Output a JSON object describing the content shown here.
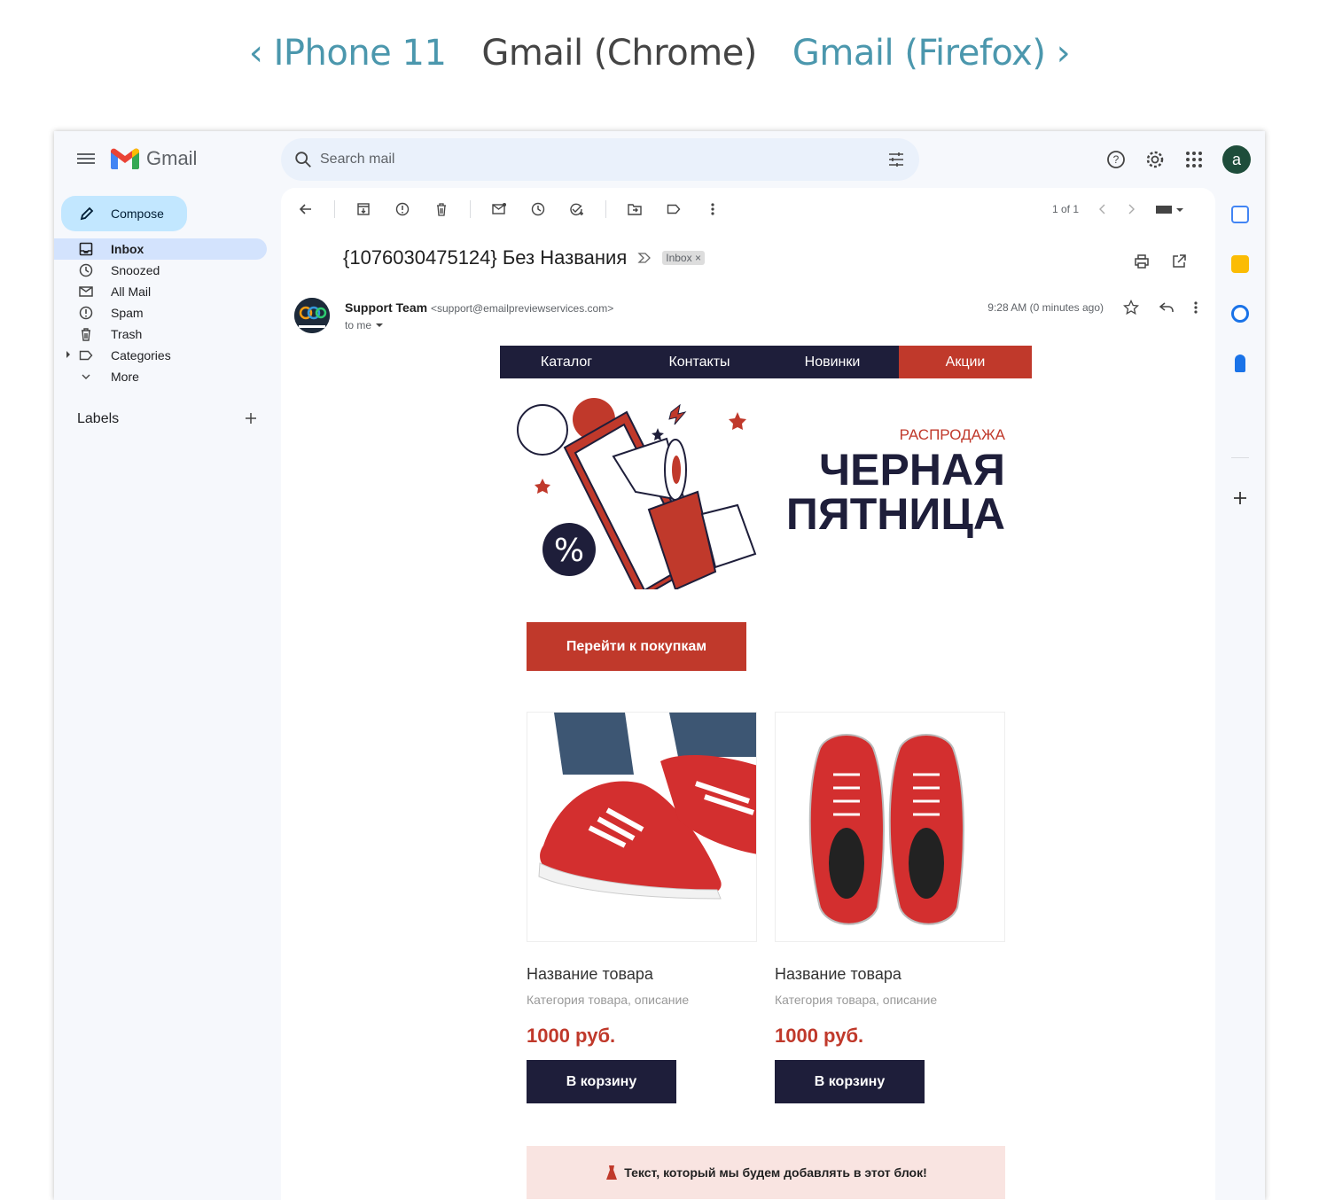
{
  "preview_nav": {
    "prev": "‹ IPhone 11",
    "current": "Gmail (Chrome)",
    "next": "Gmail (Firefox) ›"
  },
  "gmail": {
    "logo_text": "Gmail",
    "search_placeholder": "Search mail",
    "avatar_letter": "a",
    "compose_label": "Compose",
    "nav": [
      {
        "label": "Inbox",
        "icon": "inbox-icon"
      },
      {
        "label": "Snoozed",
        "icon": "clock-icon"
      },
      {
        "label": "All Mail",
        "icon": "all-mail-icon"
      },
      {
        "label": "Spam",
        "icon": "spam-icon"
      },
      {
        "label": "Trash",
        "icon": "trash-icon"
      },
      {
        "label": "Categories",
        "icon": "label-icon"
      },
      {
        "label": "More",
        "icon": "chevron-down-icon"
      }
    ],
    "labels_heading": "Labels",
    "pager_text": "1 of 1",
    "subject": "{1076030475124} Без Названия",
    "inbox_chip": "Inbox ×",
    "sender_name": "Support Team",
    "sender_email": "<support@emailpreviewservices.com>",
    "to_me": "to me",
    "time": "9:28 AM (0 minutes ago)"
  },
  "email": {
    "menu": [
      "Каталог",
      "Контакты",
      "Новинки",
      "Акции"
    ],
    "sale_label": "РАСПРОДАЖА",
    "title_line1": "ЧЕРНАЯ",
    "title_line2": "ПЯТНИЦА",
    "shop_button": "Перейти к покупкам",
    "products": [
      {
        "name": "Название товара",
        "category": "Категория товара, описание",
        "price": "1000 руб.",
        "button": "В корзину"
      },
      {
        "name": "Название товара",
        "category": "Категория товара, описание",
        "price": "1000 руб.",
        "button": "В корзину"
      }
    ],
    "note_text": "Текст, который мы будем добавлять в этот блок!"
  },
  "colors": {
    "accent_red": "#c0392b",
    "navy": "#1e1e3a",
    "link_teal": "#4b97ad"
  }
}
